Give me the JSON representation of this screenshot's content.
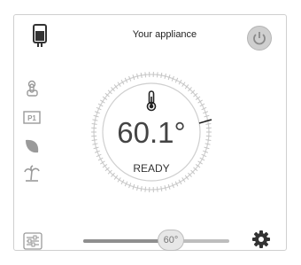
{
  "header": {
    "title": "Your appliance"
  },
  "dial": {
    "temperature": "60.1°",
    "status": "READY",
    "tick_count": 90
  },
  "slider": {
    "label": "60°",
    "value_fraction": 0.6
  },
  "icons": {
    "device": "water-heater-icon",
    "power": "power-icon",
    "thermometer": "thermometer-icon",
    "mode_touch": "touch-mode-icon",
    "mode_program": "program-p1-icon",
    "mode_eco": "eco-leaf-icon",
    "mode_holiday": "holiday-palm-icon",
    "settings_sliders": "sliders-icon",
    "settings_gear": "gear-icon"
  },
  "colors": {
    "icon_grey": "#9a9a9a",
    "dark": "#333333",
    "track": "#bdbdbd"
  }
}
